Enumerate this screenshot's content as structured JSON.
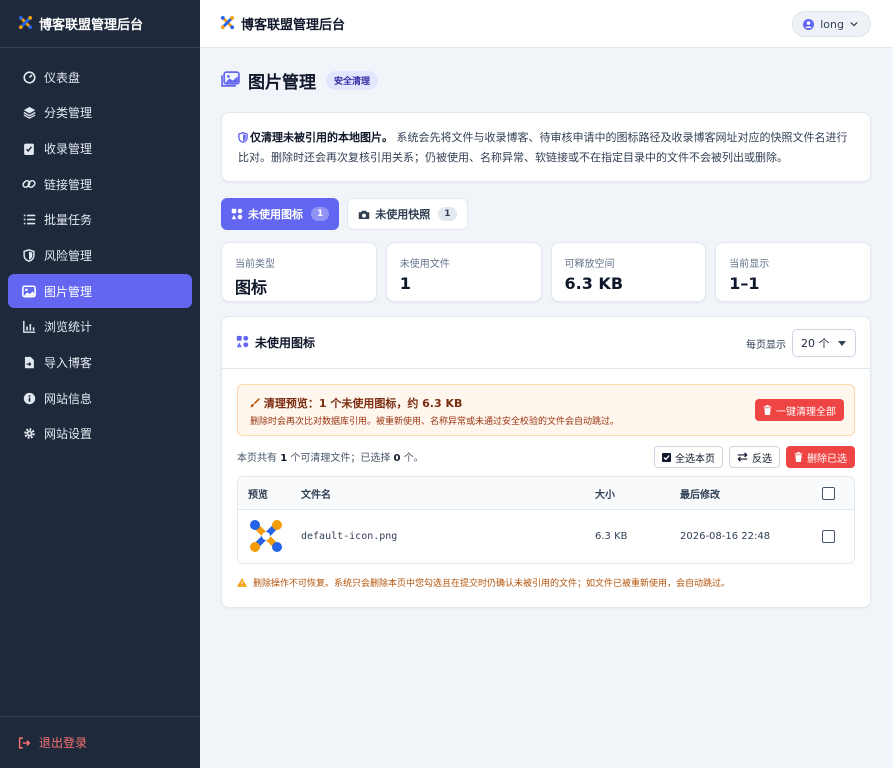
{
  "app": {
    "brand": "博客联盟管理后台"
  },
  "sidebar": {
    "items": [
      {
        "label": "仪表盘",
        "icon": "gauge-icon"
      },
      {
        "label": "分类管理",
        "icon": "layers-icon"
      },
      {
        "label": "收录管理",
        "icon": "clipboard-check-icon"
      },
      {
        "label": "链接管理",
        "icon": "link-icon"
      },
      {
        "label": "批量任务",
        "icon": "list-icon"
      },
      {
        "label": "风险管理",
        "icon": "shield-icon"
      },
      {
        "label": "图片管理",
        "icon": "image-icon",
        "active": true
      },
      {
        "label": "浏览统计",
        "icon": "bar-chart-icon"
      },
      {
        "label": "导入博客",
        "icon": "file-import-icon"
      },
      {
        "label": "网站信息",
        "icon": "info-icon"
      },
      {
        "label": "网站设置",
        "icon": "gear-icon"
      }
    ],
    "logout": "退出登录"
  },
  "topbar": {
    "title": "博客联盟管理后台",
    "user": "long"
  },
  "page": {
    "title": "图片管理",
    "badge": "安全清理"
  },
  "notice": {
    "bold": "仅清理未被引用的本地图片。",
    "text": "系统会先将文件与收录博客、待审核申请中的图标路径及收录博客网址对应的快照文件名进行比对。删除时还会再次复核引用关系；仍被使用、名称异常、软链接或不在指定目录中的文件不会被列出或删除。"
  },
  "tabs": [
    {
      "label": "未使用图标",
      "count": "1",
      "active": true
    },
    {
      "label": "未使用快照",
      "count": "1",
      "active": false
    }
  ],
  "stats": [
    {
      "key": "当前类型",
      "value": "图标"
    },
    {
      "key": "未使用文件",
      "value": "1"
    },
    {
      "key": "可释放空间",
      "value": "6.3 KB"
    },
    {
      "key": "当前显示",
      "value": "1–1"
    }
  ],
  "panel": {
    "title": "未使用图标",
    "per_page_label": "每页显示",
    "per_page_value": "20 个",
    "warn_title": "清理预览：1 个未使用图标，约 6.3 KB",
    "warn_text": "删除时会再次比对数据库引用。被重新使用、名称异常或未通过安全校验的文件会自动跳过。",
    "clean_all": "一键清理全部",
    "info_prefix": "本页共有",
    "info_count": "1",
    "info_mid": "个可清理文件；已选择",
    "info_selected": "0",
    "info_suffix": "个。",
    "select_page": "全选本页",
    "invert": "反选",
    "delete_selected": "删除已选",
    "columns": {
      "preview": "预览",
      "name": "文件名",
      "size": "大小",
      "modified": "最后修改"
    },
    "rows": [
      {
        "name": "default-icon.png",
        "size": "6.3 KB",
        "modified": "2026-08-16 22:48"
      }
    ],
    "footer": "删除操作不可恢复。系统只会删除本页中您勾选且在提交时仍确认未被引用的文件；如文件已被重新使用，会自动跳过。"
  },
  "colors": {
    "accent": "#6366f1",
    "sidebar_bg": "#1e293b",
    "danger": "#ef4444",
    "logo_blue": "#2563eb",
    "logo_orange": "#f59e0b"
  }
}
